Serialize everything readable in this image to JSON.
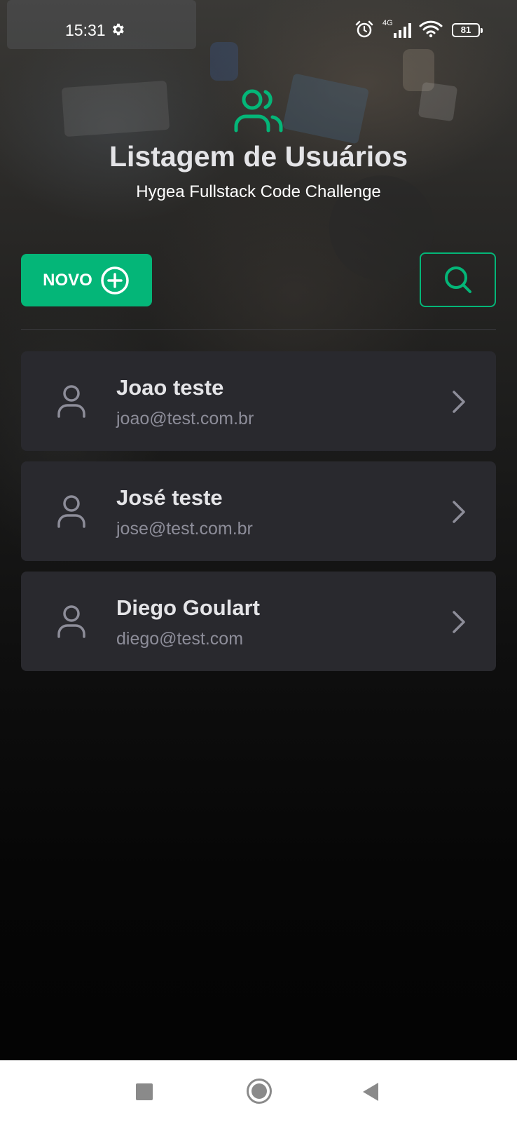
{
  "status_bar": {
    "time": "15:31",
    "network": "4G",
    "battery": "81"
  },
  "header": {
    "icon": "users-icon",
    "title": "Listagem de Usuários",
    "subtitle": "Hygea Fullstack Code Challenge"
  },
  "actions": {
    "new_label": "NOVO",
    "new_icon": "plus-circle-icon",
    "search_icon": "search-icon"
  },
  "users": [
    {
      "name": "Joao teste",
      "email": "joao@test.com.br"
    },
    {
      "name": "José teste",
      "email": "jose@test.com.br"
    },
    {
      "name": "Diego Goulart",
      "email": "diego@test.com"
    }
  ],
  "nav": {
    "items": [
      "recent-apps",
      "home",
      "back"
    ]
  },
  "colors": {
    "accent": "#04b678",
    "card": "#29292e",
    "title": "#e4e4e7",
    "muted": "#8d8d99"
  }
}
